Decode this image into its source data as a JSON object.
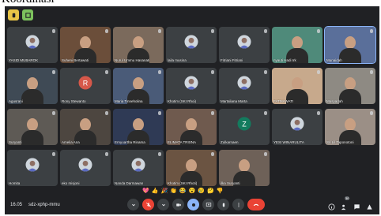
{
  "caption_fragment": "Koordinasi",
  "meeting": {
    "time": "16.05",
    "code": "sdz-xphp-mmu",
    "participant_count": "30"
  },
  "tiles": [
    {
      "name": "YASID MUBAROK",
      "bg": "#3c4043",
      "kind": "photo"
    },
    {
      "name": "Suheni Bertawati",
      "bg": "#6b4e3a",
      "kind": "video"
    },
    {
      "name": "Nurul Ummu Hasanati",
      "bg": "#7b6a5c",
      "kind": "video"
    },
    {
      "name": "laila musina",
      "bg": "#3c4043",
      "kind": "photo"
    },
    {
      "name": "Fitriani Fitriani",
      "bg": "#3c4043",
      "kind": "photo"
    },
    {
      "name": "nyauti Hadi Irk",
      "bg": "#4f8a7a",
      "kind": "video"
    },
    {
      "name": "Munaidah",
      "bg": "#5a6f9a",
      "kind": "video",
      "active": true
    },
    {
      "name": "Agusrani",
      "bg": "#3f4a55",
      "kind": "video"
    },
    {
      "name": "Rony Stewanto",
      "bg": "#3c4043",
      "kind": "letter",
      "letter": "R",
      "avatar_color": "#d6584a"
    },
    {
      "name": "Maria Tinneholina",
      "bg": "#4a5b78",
      "kind": "video"
    },
    {
      "name": "Khotim (SKI Rhoi)",
      "bg": "#3c4043",
      "kind": "photo"
    },
    {
      "name": "Martaliana Marta",
      "bg": "#3c4043",
      "kind": "photo"
    },
    {
      "name": "FATMAWATI",
      "bg": "#c7a98c",
      "kind": "video"
    },
    {
      "name": "Musyadah",
      "bg": "#8e8a83",
      "kind": "video"
    },
    {
      "name": "Suryanti",
      "bg": "#5e5a55",
      "kind": "video"
    },
    {
      "name": "Amelia Ana",
      "bg": "#4d4640",
      "kind": "video"
    },
    {
      "name": "Ernyuartha Rinama",
      "bg": "#2f3a55",
      "kind": "video"
    },
    {
      "name": "ELIMATA TRISNA",
      "bg": "#6f5a4e",
      "kind": "video"
    },
    {
      "name": "Zulkarnaen",
      "bg": "#3c4043",
      "kind": "letter",
      "letter": "Z",
      "avatar_color": "#137b5e"
    },
    {
      "name": "YESI WINARULITA",
      "bg": "#3c4043",
      "kind": "photo"
    },
    {
      "name": "Sri Lil Taponotoni",
      "bg": "#9b8f86",
      "kind": "video"
    },
    {
      "name": "Homita",
      "bg": "#3c4043",
      "kind": "photo"
    },
    {
      "name": "eko misjoni",
      "bg": "#3c4043",
      "kind": "photo"
    },
    {
      "name": "Nanda Darmawan",
      "bg": "#3c4043",
      "kind": "photo"
    },
    {
      "name": "Khotim (SKI Rhoti)",
      "bg": "#6b5442",
      "kind": "video"
    },
    {
      "name": "ilka Suryanti",
      "bg": "#6e6158",
      "kind": "video"
    }
  ],
  "reactions": [
    "💖",
    "👍",
    "🎉",
    "👏",
    "😂",
    "😮",
    "😢",
    "🤔",
    "👎"
  ]
}
